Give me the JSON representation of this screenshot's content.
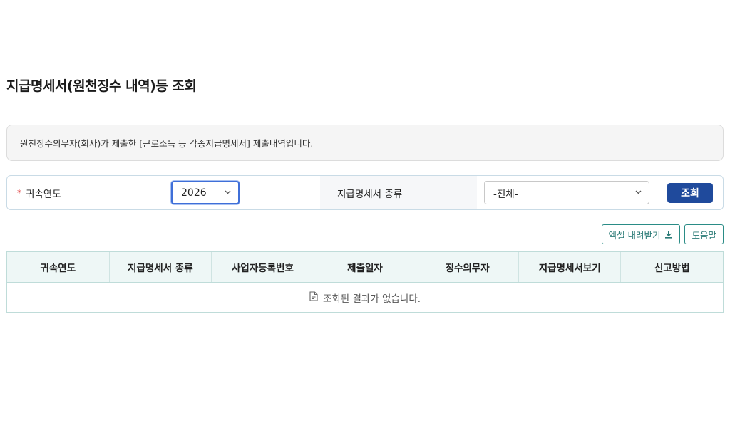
{
  "page": {
    "title": "지급명세서(원천징수 내역)등 조회",
    "info_text": "원천징수의무자(회사)가 제출한 [근로소득 등 각종지급명세서] 제출내역입니다."
  },
  "search": {
    "required_mark": "*",
    "year_label": "귀속연도",
    "year_value": "2026",
    "kind_label": "지급명세서 종류",
    "kind_value": "-전체-",
    "search_button": "조회"
  },
  "actions": {
    "excel_download": "엑셀 내려받기",
    "help": "도움말"
  },
  "table": {
    "columns": [
      "귀속연도",
      "지급명세서 종류",
      "사업자등록번호",
      "제출일자",
      "징수의무자",
      "지급명세서보기",
      "신고방법"
    ],
    "empty_message": "조회된 결과가 없습니다."
  },
  "icons": {
    "chevron": "chevron-down-icon",
    "download": "download-icon",
    "document": "document-icon"
  },
  "colors": {
    "primary": "#1f4a9c",
    "accent_teal": "#2a8c86",
    "required": "#e03a3a"
  }
}
